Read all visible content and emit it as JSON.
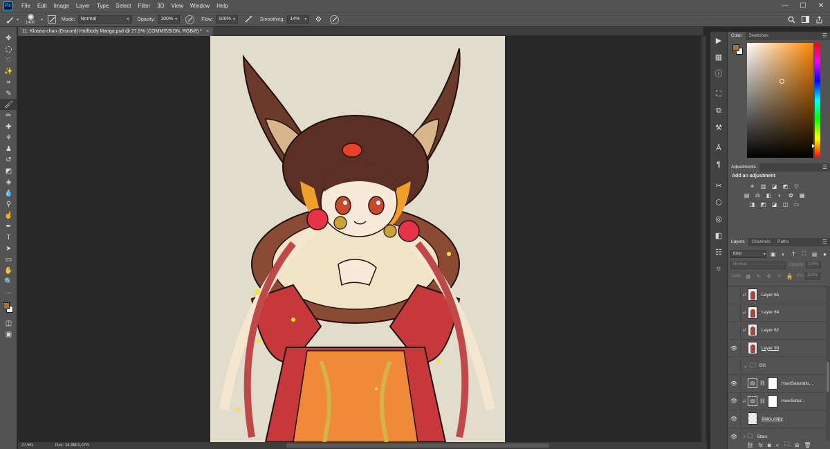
{
  "menubar": {
    "logo": "Ps",
    "items": [
      "File",
      "Edit",
      "Image",
      "Layer",
      "Type",
      "Select",
      "Filter",
      "3D",
      "View",
      "Window",
      "Help"
    ],
    "window_controls": [
      "—",
      "☐",
      "✕"
    ]
  },
  "options": {
    "brush_size": "1400",
    "mode_label": "Mode:",
    "mode_value": "Normal",
    "opacity_label": "Opacity:",
    "opacity_value": "100%",
    "flow_label": "Flow:",
    "flow_value": "100%",
    "smoothing_label": "Smoothing:",
    "smoothing_value": "14%"
  },
  "document": {
    "tab_title": "11. Kloana-chan (Discord) Halfbody Manga.psd @ 27,5% (COMMISSION, RGB/8) *",
    "close_glyph": "×",
    "zoom": "27,5%",
    "doc_info": "Doc: 24,9M/1,07G"
  },
  "colors": {
    "foreground": "#a5723e",
    "background": "#ffffff",
    "canvas_bg": "#e1dccb",
    "ui_panel": "#535353",
    "ui_dark": "#282828"
  },
  "color_panel": {
    "tabs": [
      "Color",
      "Swatches"
    ]
  },
  "adjustments_panel": {
    "tabs": [
      "Adjustments"
    ],
    "title": "Add an adjustment"
  },
  "layers_panel": {
    "tabs": [
      "Layers",
      "Channels",
      "Paths"
    ],
    "kind": "Kind",
    "blend": "Normal",
    "opacity_label": "Opacity:",
    "opacity_value": "100%",
    "lock_label": "Lock:",
    "fill_label": "Fill:",
    "fill_value": "100%",
    "layers": [
      {
        "name": "Layer 65",
        "visible": false,
        "clipped": true,
        "thumb": "art",
        "underline": false
      },
      {
        "name": "Layer 64",
        "visible": false,
        "clipped": true,
        "thumb": "art",
        "underline": false
      },
      {
        "name": "Layer 62",
        "visible": false,
        "clipped": true,
        "thumb": "art",
        "underline": false
      },
      {
        "name": "Layer 38",
        "visible": true,
        "clipped": false,
        "thumb": "art",
        "underline": true
      },
      {
        "name": "BG",
        "visible": false,
        "clipped": false,
        "thumb": "group-open",
        "underline": false
      },
      {
        "name": "Hue/Saturatio...",
        "visible": true,
        "clipped": false,
        "thumb": "adjustment",
        "underline": false
      },
      {
        "name": "Hue/Satur...",
        "visible": true,
        "clipped": true,
        "thumb": "adjustment",
        "underline": false
      },
      {
        "name": "Stars copy",
        "visible": true,
        "clipped": false,
        "thumb": "checker",
        "underline": true
      },
      {
        "name": "Stars",
        "visible": true,
        "clipped": false,
        "thumb": "group-closed",
        "underline": false
      }
    ]
  },
  "icons": {
    "search": "search-icon",
    "workspace": "workspace-icon",
    "share": "share-icon",
    "settings": "gear-icon"
  }
}
